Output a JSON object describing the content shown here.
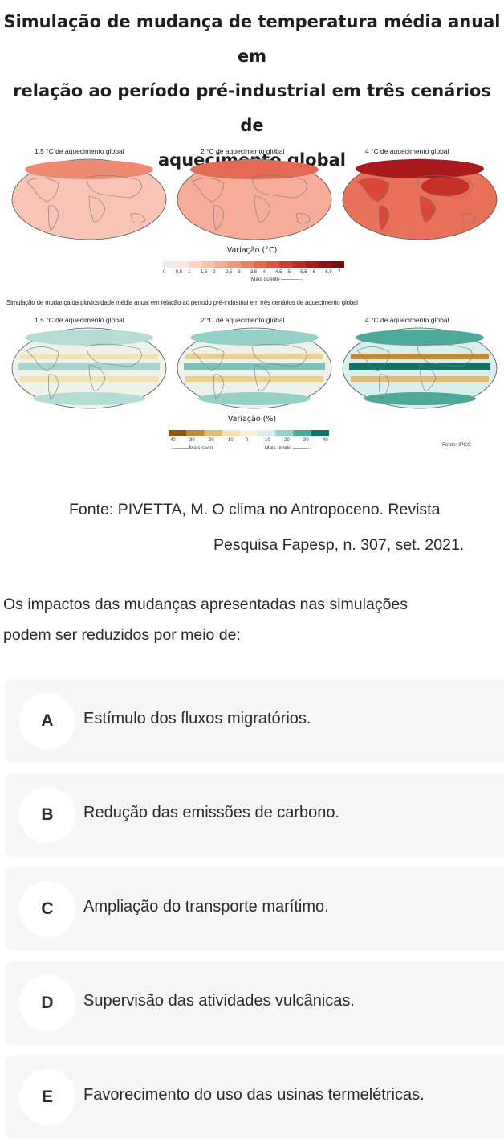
{
  "title_lines": [
    "Simulação de mudança de temperatura média anual em",
    "relação ao período pré-industrial em três cenários de",
    "aquecimento global"
  ],
  "figure": {
    "temperature": {
      "map_labels": [
        "1,5 °C de aquecimento global",
        "2 °C de aquecimento global",
        "4 °C de aquecimento global"
      ],
      "legend_title": "Variação (°C)",
      "ticks": [
        "0",
        "0,5",
        "1",
        "1,5",
        "2",
        "2,5",
        "3",
        "3,5",
        "4",
        "4,5",
        "5",
        "5,5",
        "6",
        "6,5",
        "7"
      ],
      "direction_label": "Mais quente",
      "colors": [
        "#e8eef6",
        "#fde6df",
        "#fcd3c6",
        "#fbbfae",
        "#f8a994",
        "#f5937c",
        "#f07d66",
        "#e96752",
        "#e05241",
        "#d23c31",
        "#c12a24",
        "#ab1b1b",
        "#931216",
        "#7c0b12"
      ]
    },
    "precipitation": {
      "subtitle": "Simulação de mudança da pluviosidade média anual em relação ao período pré-industrial em três cenários de aquecimento global",
      "map_labels": [
        "1,5 °C de aquecimento global",
        "2 °C de aquecimento global",
        "4 °C de aquecimento global"
      ],
      "legend_title": "Variação (%)",
      "ticks": [
        "-40",
        "-30",
        "-20",
        "-10",
        "0",
        "10",
        "20",
        "30",
        "40"
      ],
      "dry_label": "Mais seco",
      "wet_label": "Mais úmido",
      "source_note": "Fonte: IPCC",
      "colors": [
        "#8c5415",
        "#bf8a3c",
        "#dcbc7c",
        "#f1e2b8",
        "#f7f1dd",
        "#d8efeb",
        "#95d1c6",
        "#4fa99a",
        "#137368"
      ]
    }
  },
  "source_lines": [
    "Fonte: PIVETTA, M. O clima no Antropoceno. Revista",
    "Pesquisa Fapesp, n. 307, set. 2021."
  ],
  "question_lines": [
    "Os impactos das mudanças apresentadas nas simulações",
    "podem ser reduzidos por meio de:"
  ],
  "options": [
    {
      "letter": "A",
      "text": "Estímulo dos fluxos migratórios."
    },
    {
      "letter": "B",
      "text": "Redução das emissões de carbono."
    },
    {
      "letter": "C",
      "text": "Ampliação do transporte marítimo."
    },
    {
      "letter": "D",
      "text": "Supervisão das atividades vulcânicas."
    },
    {
      "letter": "E",
      "text": "Favorecimento do uso das usinas termelétricas."
    }
  ]
}
